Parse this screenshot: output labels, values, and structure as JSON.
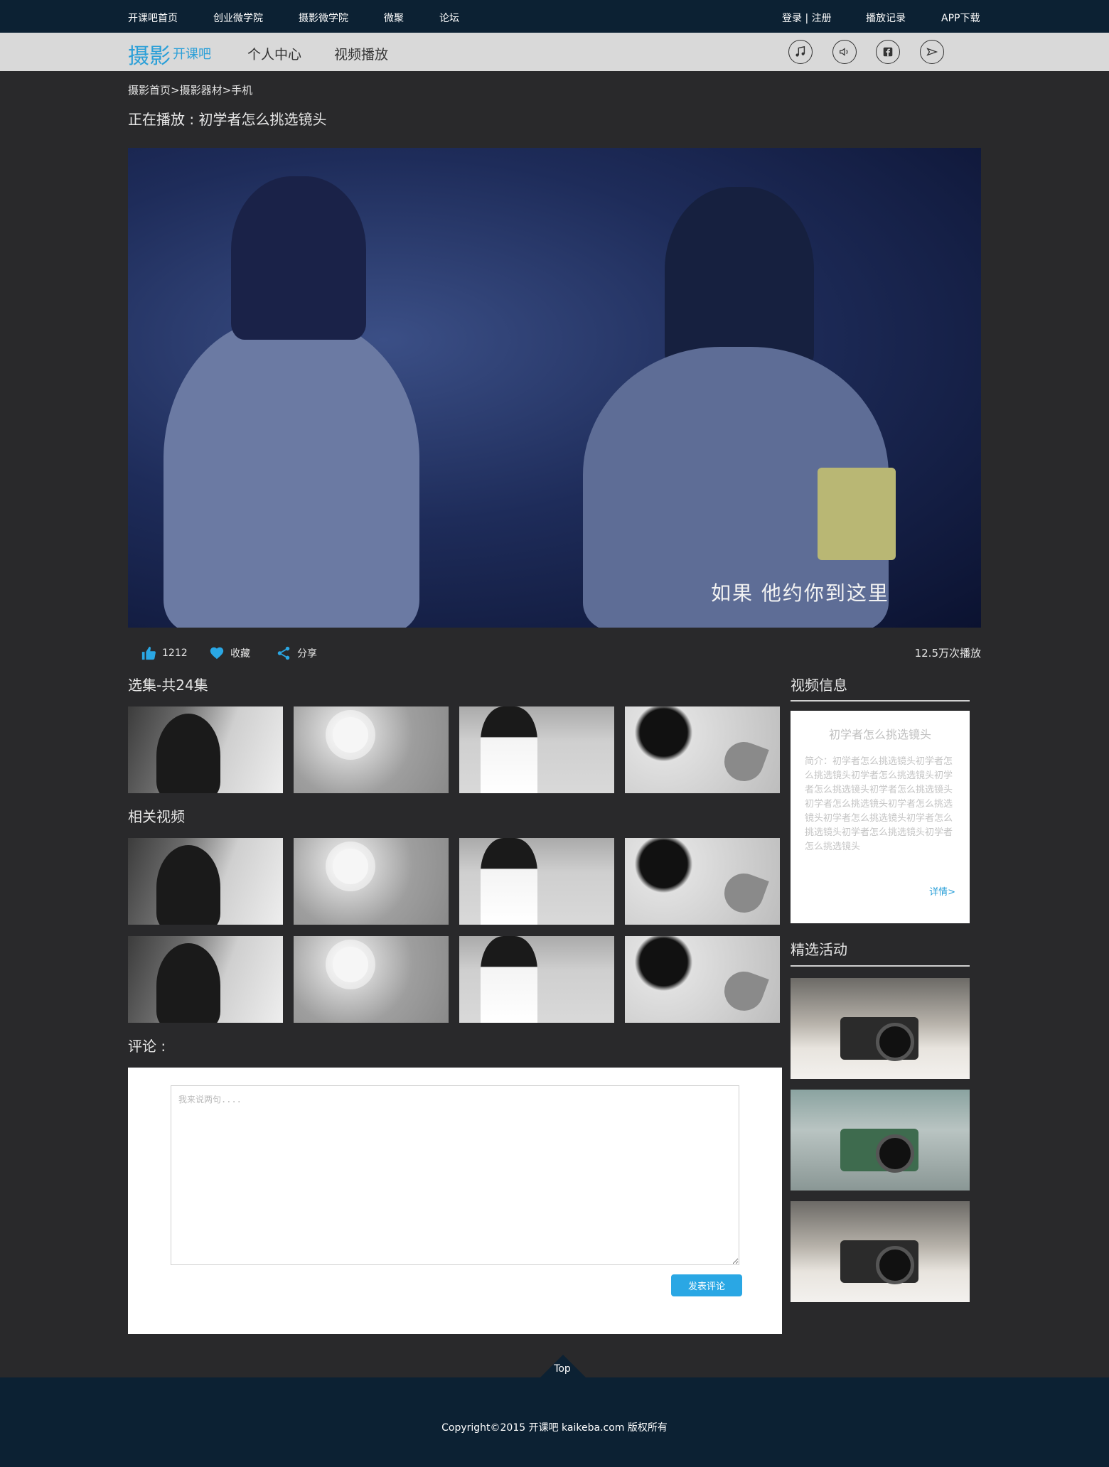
{
  "topbar": {
    "nav": [
      "开课吧首页",
      "创业微学院",
      "摄影微学院",
      "微聚",
      "论坛"
    ],
    "login": "登录 | 注册",
    "history": "播放记录",
    "app": "APP下载"
  },
  "subbar": {
    "logo_main": "摄影",
    "logo_sub": "开课吧",
    "nav": [
      "个人中心",
      "视频播放"
    ],
    "icons": [
      "music-icon",
      "volume-icon",
      "facebook-icon",
      "send-icon"
    ]
  },
  "breadcrumb": "摄影首页>摄影器材>手机",
  "now_playing": "正在播放 : 初学者怎么挑选镜头",
  "video": {
    "subtitle": "如果  他约你到这里"
  },
  "actions": {
    "like_count": "1212",
    "favorite": "收藏",
    "share": "分享",
    "plays": "12.5万次播放"
  },
  "episodes": {
    "title": "选集-共24集"
  },
  "related": {
    "title": "相关视频"
  },
  "comments": {
    "title": "评论 :",
    "placeholder": "我来说两句....",
    "submit": "发表评论"
  },
  "sidebar": {
    "info_title": "视频信息",
    "info_name": "初学者怎么挑选镜头",
    "info_desc": "简介：初学者怎么挑选镜头初学者怎么挑选镜头初学者怎么挑选镜头初学者怎么挑选镜头初学者怎么挑选镜头初学者怎么挑选镜头初学者怎么挑选镜头初学者怎么挑选镜头初学者怎么挑选镜头初学者怎么挑选镜头初学者怎么挑选镜头",
    "info_more": "详情>",
    "activity_title": "精选活动"
  },
  "footer": {
    "top": "Top",
    "copyright": "Copyright©2015 开课吧 kaikeba.com 版权所有"
  },
  "colors": {
    "accent": "#2a9fd8",
    "topbar": "#0c2133",
    "background": "#29292b"
  }
}
